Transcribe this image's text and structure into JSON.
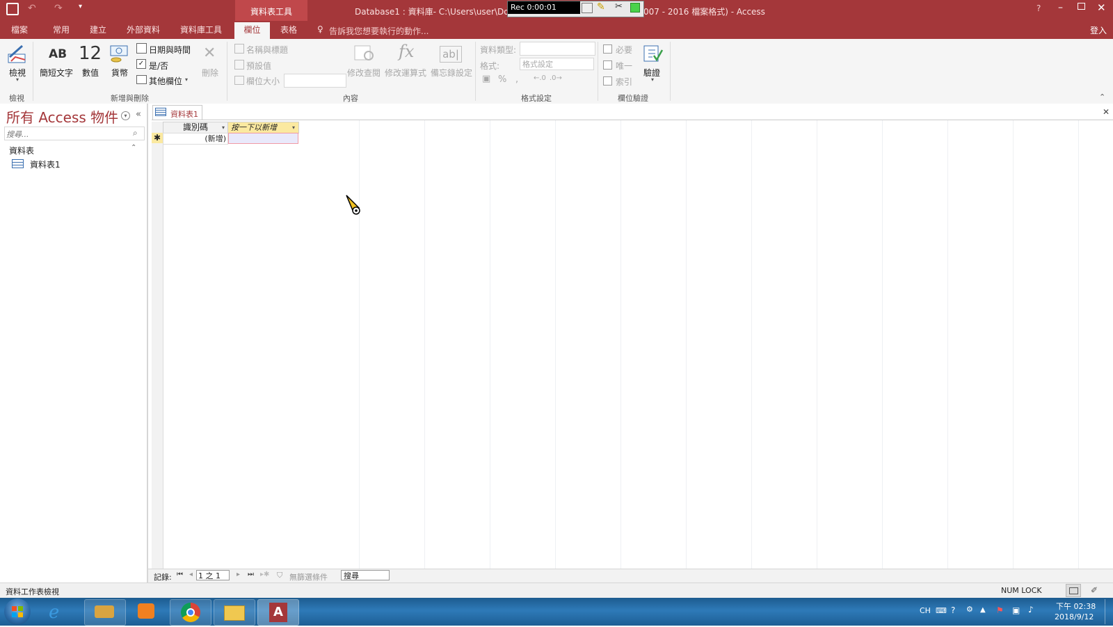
{
  "window": {
    "title": "Database1 : 資料庫- C:\\Users\\user\\Docu",
    "title_suffix": "007 - 2016 檔案格式) - Access",
    "context_tab_group": "資料表工具",
    "help": "?",
    "sign_in": "登入"
  },
  "recorder": {
    "time": "Rec 0:00:01"
  },
  "ribbon_tabs": [
    "檔案",
    "常用",
    "建立",
    "外部資料",
    "資料庫工具",
    "欄位",
    "表格"
  ],
  "tell_me": "告訴我您想要執行的動作...",
  "ribbon": {
    "view": {
      "label": "檢視",
      "group": "檢視"
    },
    "add_delete": {
      "group": "新增與刪除",
      "short_text": "簡短文字",
      "number": "數值",
      "number_glyph": "12",
      "ab_glyph": "AB",
      "currency": "貨幣",
      "datetime": "日期與時間",
      "yesno": "是/否",
      "more_fields": "其他欄位",
      "delete": "刪除"
    },
    "properties": {
      "group": "內容",
      "name_caption": "名稱與標題",
      "default_value": "預設值",
      "field_size": "欄位大小",
      "modify_lookups": "修改查閱",
      "modify_expression": "修改運算式",
      "memo_settings": "備忘錄設定",
      "fx_glyph": "fx",
      "ab_box_glyph": "ab|"
    },
    "formatting": {
      "group": "格式設定",
      "data_type": "資料類型:",
      "format": "格式:",
      "format_value": "格式設定"
    },
    "validation": {
      "group": "欄位驗證",
      "required": "必要",
      "unique": "唯一",
      "indexed": "索引",
      "validation": "驗證"
    }
  },
  "nav_pane": {
    "title": "所有 Access 物件",
    "search_placeholder": "搜尋...",
    "section": "資料表",
    "items": [
      "資料表1"
    ]
  },
  "document": {
    "tab_label": "資料表1",
    "columns": [
      "識別碼",
      "按一下以新增"
    ],
    "new_row_label": "(新增)",
    "new_row_marker": "✱"
  },
  "record_nav": {
    "label": "記錄:",
    "position": "1 之 1",
    "filter": "無篩選條件",
    "search": "搜尋"
  },
  "status": {
    "left": "資料工作表檢視",
    "num_lock": "NUM LOCK"
  },
  "tray": {
    "lang": "CH",
    "time": "下午 02:38",
    "date": "2018/9/12"
  }
}
